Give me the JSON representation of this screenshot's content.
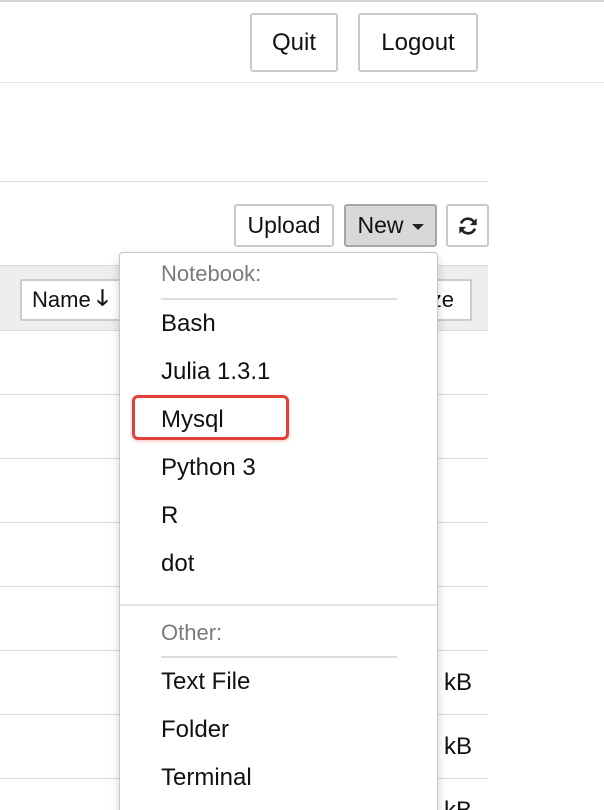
{
  "header": {
    "quit_label": "Quit",
    "logout_label": "Logout"
  },
  "toolbar": {
    "upload_label": "Upload",
    "new_label": "New",
    "refresh_icon": "refresh-icon"
  },
  "file_list": {
    "columns": {
      "name_label": "Name",
      "name_sort_icon": "arrow-down-icon",
      "size_label": "ze"
    },
    "rows": [
      {
        "size": ""
      },
      {
        "size": ""
      },
      {
        "size": ""
      },
      {
        "size": ""
      },
      {
        "size": ""
      },
      {
        "size": "kB"
      },
      {
        "size": "kB"
      },
      {
        "size": "kB"
      }
    ]
  },
  "new_menu": {
    "notebook_header": "Notebook:",
    "notebook_items": [
      "Bash",
      "Julia 1.3.1",
      "Mysql",
      "Python 3",
      "R",
      "dot"
    ],
    "other_header": "Other:",
    "other_items": [
      "Text File",
      "Folder",
      "Terminal"
    ],
    "highlighted_item": "Mysql"
  },
  "colors": {
    "highlight": "#e0423a",
    "new_button_active": "#d8d8d8",
    "menu_header_text": "#7b7b7b"
  }
}
